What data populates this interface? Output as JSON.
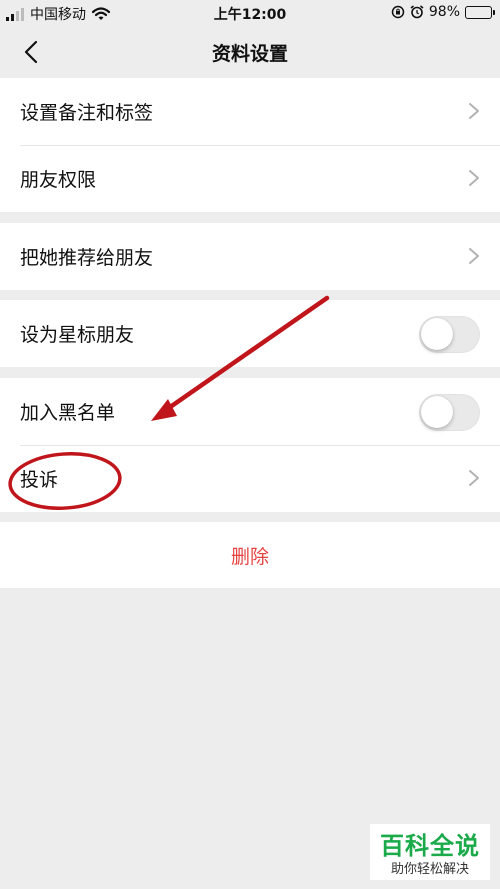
{
  "status_bar": {
    "carrier": "中国移动",
    "time": "上午12:00",
    "battery": "98%",
    "icons": [
      "signal-icon",
      "wifi-icon",
      "lock-rotation-icon",
      "alarm-icon",
      "battery-icon"
    ]
  },
  "nav": {
    "title": "资料设置",
    "back_icon": "back-chevron-icon"
  },
  "groups": {
    "g1": {
      "remark": "设置备注和标签",
      "permissions": "朋友权限"
    },
    "g2": {
      "recommend": "把她推荐给朋友"
    },
    "g3": {
      "star": "设为星标朋友",
      "star_on": false
    },
    "g4": {
      "blacklist": "加入黑名单",
      "blacklist_on": false,
      "complain": "投诉"
    }
  },
  "delete_label": "删除",
  "watermark": {
    "title": "百科全说",
    "subtitle": "助你轻松解决"
  },
  "colors": {
    "background": "#ededed",
    "delete_text": "#e64340",
    "annotation": "#c0161b",
    "watermark": "#1aaa4a"
  }
}
